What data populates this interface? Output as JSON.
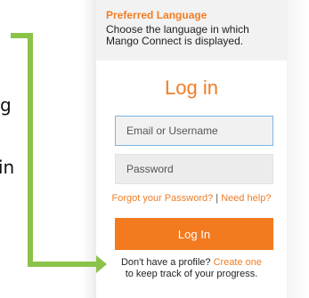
{
  "left_fragments": {
    "top": "g",
    "bottom": "in"
  },
  "colors": {
    "accent": "#f07e26",
    "button": "#f47a20",
    "arrow": "#8bc34a",
    "panel_header_bg": "#f2f2f2",
    "input_focus_border": "#80b4e6"
  },
  "preferred_language": {
    "title": "Preferred Language",
    "description": "Choose the language in which Mango Connect is displayed."
  },
  "login": {
    "heading": "Log in",
    "email_placeholder": "Email or Username",
    "password_placeholder": "Password",
    "forgot_password": "Forgot your Password?",
    "separator": "|",
    "need_help": "Need help?",
    "button_label": "Log In",
    "no_profile_text": "Don't have a profile?",
    "create_link": "Create one",
    "track_text": "to keep track of your progress."
  },
  "icons": {
    "arrow": "green-callout-arrow"
  }
}
